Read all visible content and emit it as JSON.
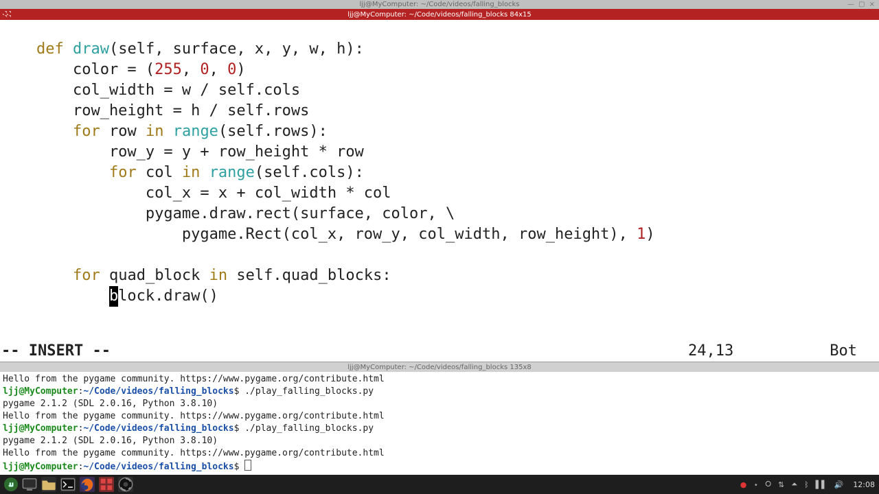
{
  "window": {
    "outer_title": "ljj@MyComputer: ~/Code/videos/falling_blocks",
    "controls": {
      "min": "—",
      "max": "▢",
      "close": "×"
    }
  },
  "editor": {
    "pane_title": "ljj@MyComputer: ~/Code/videos/falling_blocks 84x15",
    "cursor_char": "b",
    "tokens": {
      "def": "def",
      "for": "for",
      "in": "in",
      "draw": "draw",
      "range": "range",
      "n255": "255",
      "n0a": "0",
      "n0b": "0",
      "n1": "1"
    },
    "text": {
      "sig_l": "(self, surface, x, y, w, h):",
      "color_l": "        color = (",
      "color_m1": ", ",
      "color_m2": ", ",
      "color_r": ")",
      "col_width": "        col_width = w / self.cols",
      "row_height": "        row_height = h / self.rows",
      "for_row_l": "        ",
      "for_row_mid": " row ",
      "for_row_after": "(self.rows):",
      "row_y": "            row_y = y + row_height * row",
      "for_col_l": "            ",
      "for_col_mid": " col ",
      "for_col_after": "(self.cols):",
      "col_x": "                col_x = x + col_width * col",
      "drawrect": "                pygame.draw.rect(surface, color, \\",
      "rect_l": "                    pygame.Rect(col_x, row_y, col_width, row_height), ",
      "rect_r": ")",
      "for_qb_l": "        ",
      "for_qb_mid": " quad_block ",
      "for_qb_after": " self.quad_blocks:",
      "block_draw_pre": "            ",
      "block_draw_post": "lock.draw()"
    },
    "status": {
      "mode": "-- INSERT --",
      "pos": "24,13",
      "scroll": "Bot"
    }
  },
  "terminal": {
    "pane_title": "ljj@MyComputer: ~/Code/videos/falling_blocks 135x8",
    "prompt_user": "ljj@MyComputer",
    "prompt_sep1": ":",
    "prompt_path": "~/Code/videos/falling_blocks",
    "prompt_sep2": "$",
    "command": " ./play_falling_blocks.py",
    "greeting": "Hello from the pygame community. https://www.pygame.org/contribute.html",
    "version": "pygame 2.1.2 (SDL 2.0.16, Python 3.8.10)"
  },
  "taskbar": {
    "clock": "12:08",
    "tray": {
      "record": "●",
      "star": "⋆",
      "vpn": "⭘",
      "wifi": "⇅",
      "net": "⏶",
      "bt": "ᛒ",
      "batt": "▌▌",
      "vol": "🔊"
    }
  }
}
